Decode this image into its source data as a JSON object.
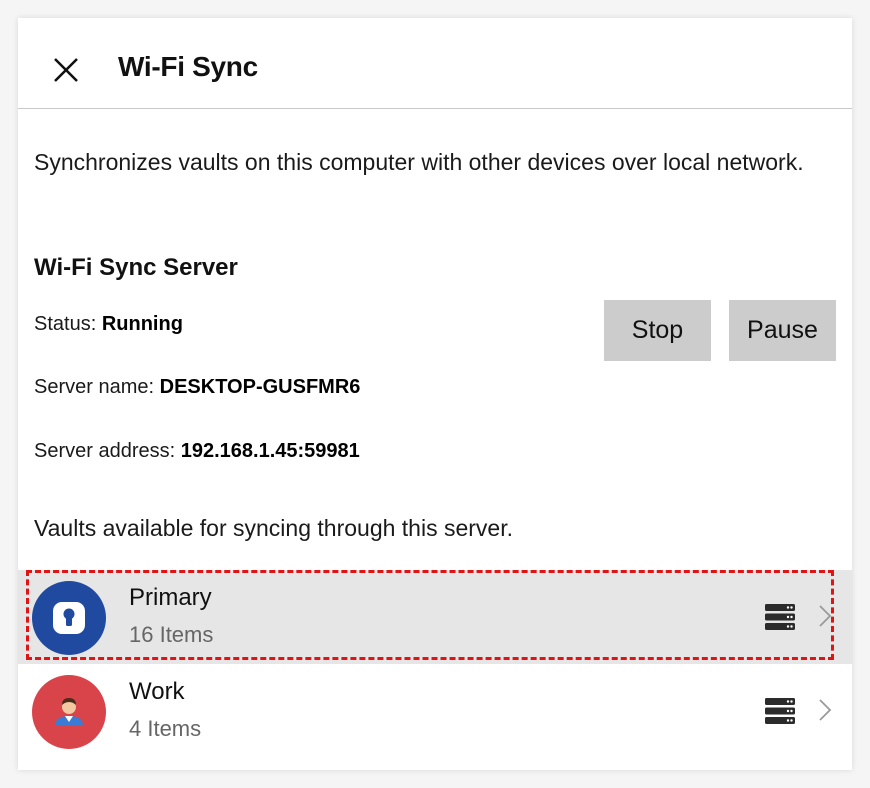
{
  "header": {
    "title": "Wi-Fi Sync",
    "close_icon": "close-icon"
  },
  "description": "Synchronizes vaults on this computer with other devices over local network.",
  "server": {
    "section_title": "Wi-Fi Sync Server",
    "status_label": "Status:",
    "status_value": "Running",
    "name_label": "Server name:",
    "name_value": "DESKTOP-GUSFMR6",
    "address_label": "Server address:",
    "address_value": "192.168.1.45:59981",
    "stop_label": "Stop",
    "pause_label": "Pause"
  },
  "vaults_caption": "Vaults available for syncing through this server.",
  "vaults": [
    {
      "name": "Primary",
      "count": "16 Items",
      "color": "#1f4aa0",
      "icon": "lock-icon",
      "selected": true
    },
    {
      "name": "Work",
      "count": "4 Items",
      "color": "#d9434a",
      "icon": "person-icon",
      "selected": false
    }
  ],
  "colors": {
    "button_bg": "#cccccc",
    "selected_row": "#e6e6e6",
    "focus_outline": "#e01414"
  }
}
